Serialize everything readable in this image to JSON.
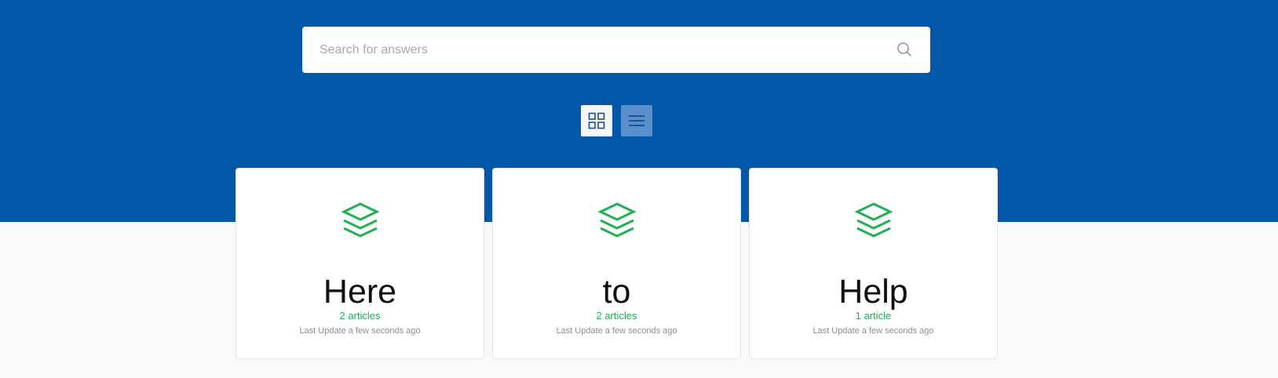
{
  "search": {
    "placeholder": "Search for answers",
    "value": ""
  },
  "view_toggle": {
    "active": "list",
    "options": [
      "grid",
      "list"
    ]
  },
  "cards": [
    {
      "title": "Here",
      "count": "2 articles",
      "updated": "Last Update a few seconds ago",
      "icon": "layers-icon"
    },
    {
      "title": "to",
      "count": "2 articles",
      "updated": "Last Update a few seconds ago",
      "icon": "layers-icon"
    },
    {
      "title": "Help",
      "count": "1 article",
      "updated": "Last Update a few seconds ago",
      "icon": "layers-icon"
    }
  ],
  "colors": {
    "hero": "#0357a8",
    "accent": "#20b155",
    "page_bg": "#f9f9f9"
  }
}
